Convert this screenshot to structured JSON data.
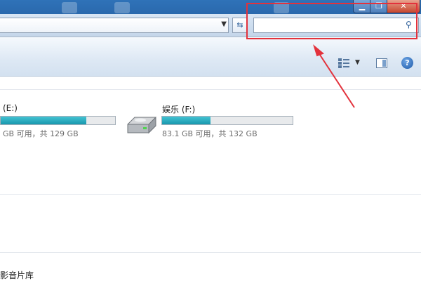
{
  "window": {
    "controls": {
      "minimize_icon": "minimize-icon",
      "maximize_icon": "restore-icon",
      "close_icon": "close-icon"
    }
  },
  "navbar": {
    "address_value": "",
    "search_placeholder": ""
  },
  "drives": [
    {
      "name": "(E:)",
      "free_text": "GB 可用，共 129 GB",
      "usage": 0.75
    },
    {
      "name": "娱乐 (F:)",
      "free_text": "83.1 GB 可用，共 132 GB",
      "usage": 0.37
    }
  ],
  "library_label": "影音片库",
  "annotation": {
    "color": "#e3323c"
  },
  "colors": {
    "bar_fill": "#1897ad",
    "toolbar": "#dde8f4"
  }
}
